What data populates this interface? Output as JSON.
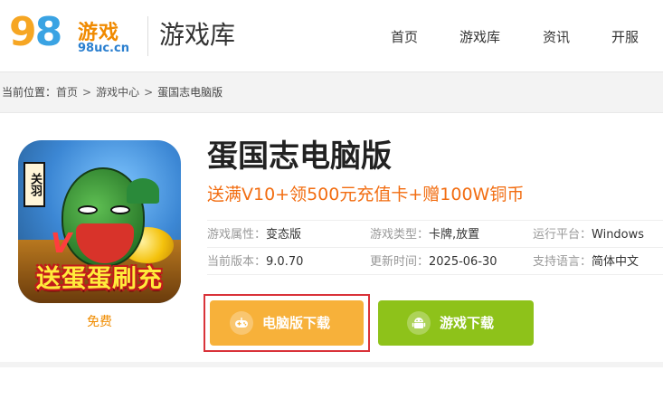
{
  "header": {
    "logo_number": "98",
    "logo_chinese": "游戏",
    "logo_url": "98uc.cn",
    "section_title": "游戏库",
    "nav": [
      {
        "label": "首页"
      },
      {
        "label": "游戏库"
      },
      {
        "label": "资讯"
      },
      {
        "label": "开服"
      }
    ]
  },
  "breadcrumb": {
    "prefix": "当前位置：",
    "items": [
      "首页",
      "游戏中心",
      "蛋国志电脑版"
    ],
    "separator": ">"
  },
  "game": {
    "icon_tag": "关羽",
    "icon_banner": "送蛋蛋刷充",
    "price": "免费",
    "title": "蛋国志电脑版",
    "promo": "送满V10+领500元充值卡+赠100W铜币",
    "info": [
      {
        "key": "游戏属性：",
        "value": "变态版"
      },
      {
        "key": "游戏类型：",
        "value": "卡牌,放置"
      },
      {
        "key": "运行平台：",
        "value": "Windows"
      },
      {
        "key": "当前版本：",
        "value": "9.0.70"
      },
      {
        "key": "更新时间：",
        "value": "2025-06-30"
      },
      {
        "key": "支持语言：",
        "value": "简体中文"
      }
    ]
  },
  "buttons": {
    "pc_download": "电脑版下载",
    "game_download": "游戏下载"
  },
  "colors": {
    "accent_orange": "#f7b13a",
    "accent_green": "#8ec21a",
    "promo": "#f26d11",
    "highlight_border": "#d9333a"
  },
  "icons": {
    "pc_button": "gamepad-icon",
    "game_button": "android-icon"
  }
}
